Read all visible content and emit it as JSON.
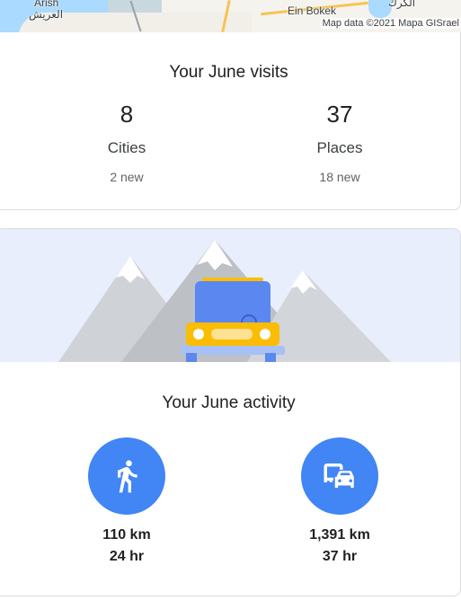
{
  "map": {
    "label_arish_en": "Arish",
    "label_arish_ar": "العريش",
    "label_ein_bokek": "Ein Bokek",
    "label_karak": "الكرك",
    "credit": "Map data ©2021 Mapa GISrael"
  },
  "visits": {
    "title": "Your June visits",
    "cities": {
      "count": "8",
      "label": "Cities",
      "sub": "2 new"
    },
    "places": {
      "count": "37",
      "label": "Places",
      "sub": "18 new"
    }
  },
  "activity": {
    "title": "Your June activity",
    "walking": {
      "icon": "walking-icon",
      "distance": "110 km",
      "time": "24 hr"
    },
    "driving": {
      "icon": "driving-icon",
      "distance": "1,391 km",
      "time": "37 hr"
    }
  },
  "colors": {
    "accent": "#4285f4",
    "banner_bg": "#e8eefc",
    "car": "#5b87f0",
    "car_roof": "#fbbc04"
  }
}
